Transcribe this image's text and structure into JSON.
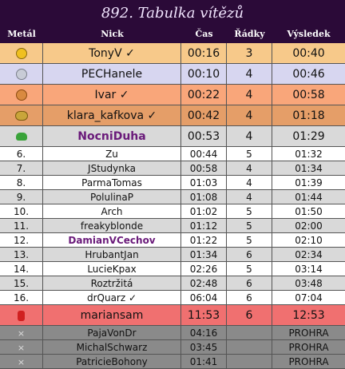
{
  "title": "892. Tabulka vítězů",
  "headers": {
    "medal": "Metál",
    "nick": "Nick",
    "time": "Čas",
    "rows": "Řádky",
    "result": "Výsledek"
  },
  "rows": [
    {
      "medal": "",
      "icon": "gold-medal-icon",
      "nick": "TonyV ✓",
      "time": "00:16",
      "rows": "3",
      "result": "00:40"
    },
    {
      "medal": "",
      "icon": "silver-medal-icon",
      "nick": "PECHanele",
      "time": "00:10",
      "rows": "4",
      "result": "00:46"
    },
    {
      "medal": "",
      "icon": "bronze-medal-icon",
      "nick": "Ivar ✓",
      "time": "00:22",
      "rows": "4",
      "result": "00:58"
    },
    {
      "medal": "",
      "icon": "potato-icon",
      "nick": "klara_kafkova ✓",
      "time": "00:42",
      "rows": "4",
      "result": "01:18"
    },
    {
      "medal": "",
      "icon": "frog-icon",
      "nick": "NocniDuha",
      "time": "00:53",
      "rows": "4",
      "result": "01:29"
    },
    {
      "medal": "6.",
      "nick": "Zu",
      "time": "00:44",
      "rows": "5",
      "result": "01:32"
    },
    {
      "medal": "7.",
      "nick": "JStudynka",
      "time": "00:58",
      "rows": "4",
      "result": "01:34"
    },
    {
      "medal": "8.",
      "nick": "ParmaTomas",
      "time": "01:03",
      "rows": "4",
      "result": "01:39"
    },
    {
      "medal": "9.",
      "nick": "PolulinaP",
      "time": "01:08",
      "rows": "4",
      "result": "01:44"
    },
    {
      "medal": "10.",
      "nick": "Arch",
      "time": "01:02",
      "rows": "5",
      "result": "01:50"
    },
    {
      "medal": "11.",
      "nick": "freakyblonde",
      "time": "01:12",
      "rows": "5",
      "result": "02:00"
    },
    {
      "medal": "12.",
      "nick": "DamianVCechov",
      "time": "01:22",
      "rows": "5",
      "result": "02:10"
    },
    {
      "medal": "13.",
      "nick": "HrubantJan",
      "time": "01:34",
      "rows": "6",
      "result": "02:34"
    },
    {
      "medal": "14.",
      "nick": "LucieKpax",
      "time": "02:26",
      "rows": "5",
      "result": "03:14"
    },
    {
      "medal": "15.",
      "nick": "Roztržitá",
      "time": "02:48",
      "rows": "6",
      "result": "03:48"
    },
    {
      "medal": "16.",
      "nick": "drQuarz ✓",
      "time": "06:04",
      "rows": "6",
      "result": "07:04"
    },
    {
      "medal": "",
      "icon": "red-bucket-icon",
      "nick": "mariansam",
      "time": "11:53",
      "rows": "6",
      "result": "12:53"
    },
    {
      "medal": "×",
      "nick": "PajaVonDr",
      "time": "04:16",
      "rows": "",
      "result": "PROHRA"
    },
    {
      "medal": "×",
      "nick": "MichalSchwarz",
      "time": "03:45",
      "rows": "",
      "result": "PROHRA"
    },
    {
      "medal": "×",
      "nick": "PatricieBohony",
      "time": "01:41",
      "rows": "",
      "result": "PROHRA"
    }
  ],
  "colors": {
    "gold": "#f7c98a",
    "silver": "#d7d6f0",
    "bronze": "#f9a67a",
    "fourth": "#e59e68",
    "frog": "#a8e89a",
    "odd": "#ffffff",
    "even": "#d9d9d9",
    "red": "#f07070",
    "lost": "#8a8a8a"
  }
}
